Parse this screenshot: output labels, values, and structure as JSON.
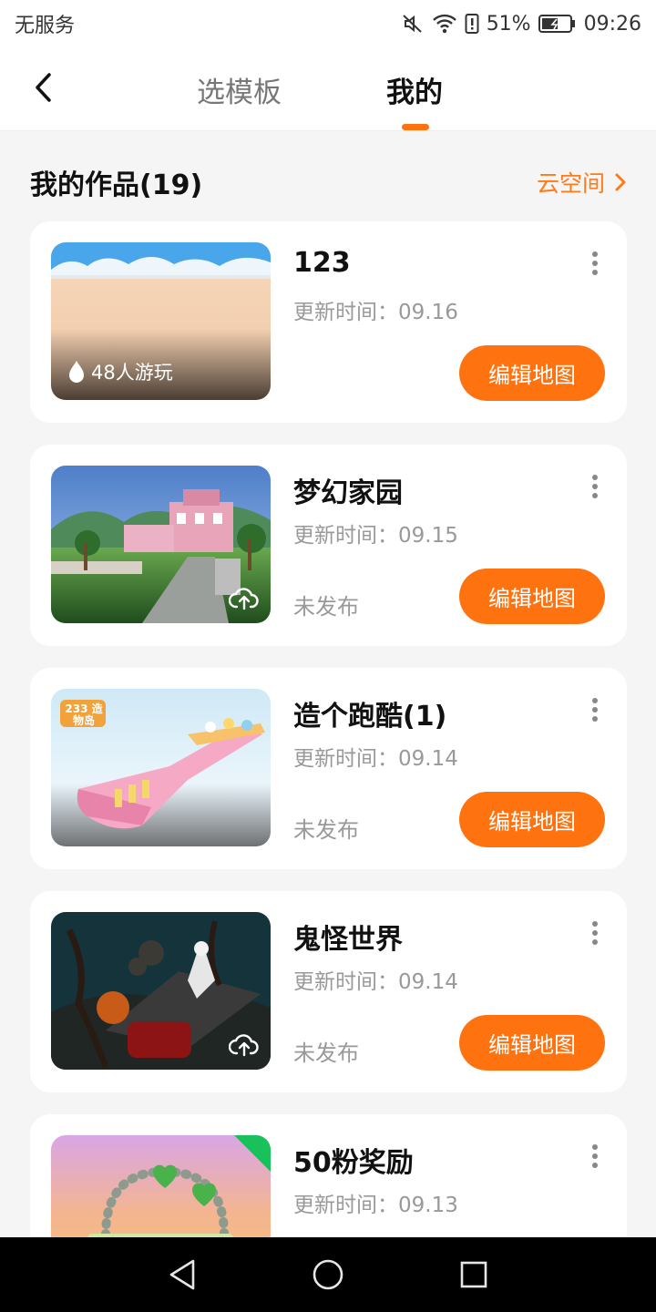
{
  "status_bar": {
    "carrier": "无服务",
    "battery_percent": "51%",
    "time": "09:26",
    "icons": [
      "mute-icon",
      "wifi-icon",
      "alert-icon",
      "battery-charging-icon"
    ]
  },
  "header": {
    "back_icon": "chevron-left-icon",
    "tabs": [
      {
        "label": "选模板",
        "active": false
      },
      {
        "label": "我的",
        "active": true
      }
    ]
  },
  "section": {
    "title": "我的作品(19)",
    "cloud_label": "云空间",
    "cloud_icon": "chevron-right-icon"
  },
  "works": [
    {
      "title": "123",
      "update_label": "更新时间：09.16",
      "play_count": "48人游玩",
      "status": "",
      "edit_label": "编辑地图"
    },
    {
      "title": "梦幻家园",
      "update_label": "更新时间：09.15",
      "play_count": "",
      "status": "未发布",
      "edit_label": "编辑地图"
    },
    {
      "title": "造个跑酷(1)",
      "update_label": "更新时间：09.14",
      "play_count": "",
      "status": "未发布",
      "edit_label": "编辑地图",
      "thumb_text": "233 造物岛"
    },
    {
      "title": "鬼怪世界",
      "update_label": "更新时间：09.14",
      "play_count": "",
      "status": "未发布",
      "edit_label": "编辑地图"
    },
    {
      "title": "50粉奖励",
      "update_label": "更新时间：09.13",
      "play_count": "",
      "status": "",
      "edit_label": ""
    }
  ],
  "colors": {
    "accent": "#ff7210",
    "card_background": "#ffffff",
    "page_background": "#f5f5f5",
    "muted_text": "#999999",
    "corner_badge": "#19c15a"
  },
  "nav_bar": {
    "icons": [
      "back-triangle-icon",
      "home-circle-icon",
      "recents-square-icon"
    ]
  }
}
